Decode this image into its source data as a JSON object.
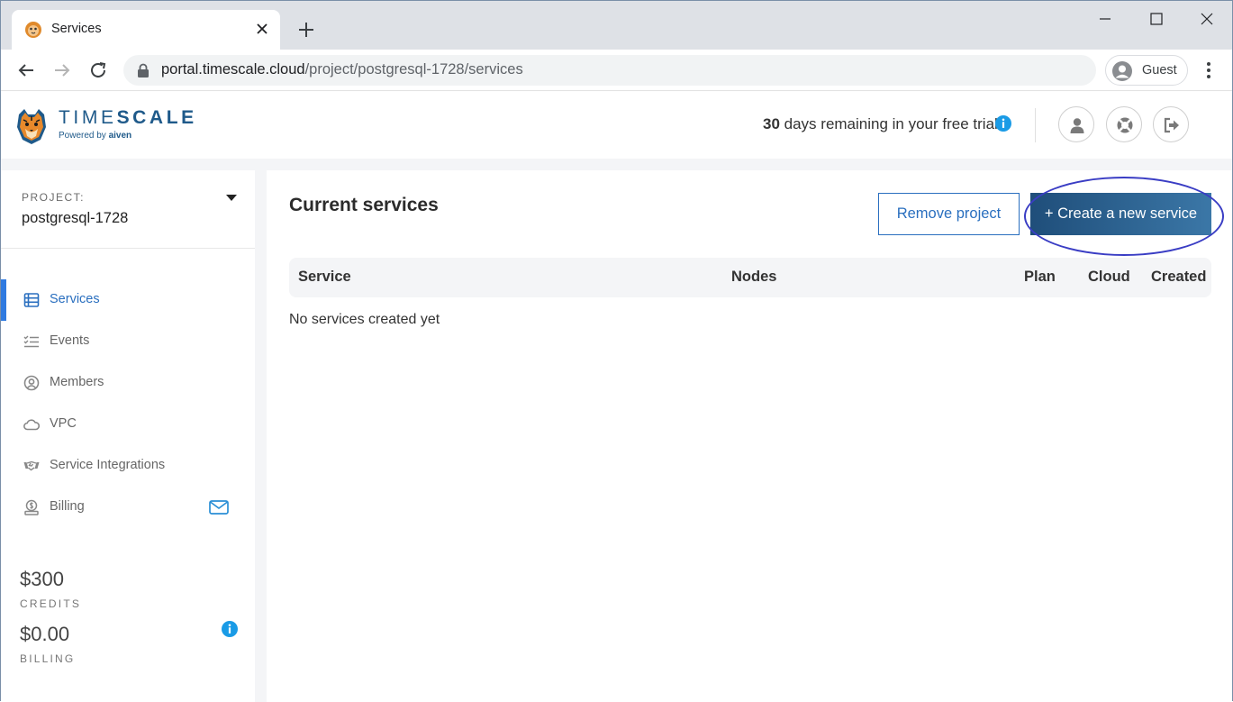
{
  "browser": {
    "tab_title": "Services",
    "url_host": "portal.timescale.cloud",
    "url_path": "/project/postgresql-1728/services",
    "profile_label": "Guest"
  },
  "header": {
    "logo_text_light": "TIME",
    "logo_text_bold": "SCALE",
    "logo_powered_by": "Powered by",
    "logo_powered_brand": "aiven",
    "trial_days": "30",
    "trial_text": " days remaining in your free trial"
  },
  "sidebar": {
    "project_label": "PROJECT:",
    "project_name": "postgresql-1728",
    "items": [
      {
        "label": "Services",
        "icon": "services-icon",
        "active": true
      },
      {
        "label": "Events",
        "icon": "events-icon",
        "active": false
      },
      {
        "label": "Members",
        "icon": "members-icon",
        "active": false
      },
      {
        "label": "VPC",
        "icon": "cloud-icon",
        "active": false
      },
      {
        "label": "Service Integrations",
        "icon": "handshake-icon",
        "active": false
      },
      {
        "label": "Billing",
        "icon": "billing-icon",
        "active": false
      }
    ],
    "credits_amount": "$300",
    "credits_label": "CREDITS",
    "billing_amount": "$0.00",
    "billing_label": "BILLING"
  },
  "main": {
    "title": "Current services",
    "remove_button": "Remove project",
    "create_button": "+ Create a new service",
    "columns": [
      "Service",
      "Nodes",
      "Plan",
      "Cloud",
      "Created"
    ],
    "empty_message": "No services created yet"
  },
  "colors": {
    "accent": "#2a6fbf",
    "brand": "#1f5a8a",
    "annotation": "#3a3dc4"
  }
}
